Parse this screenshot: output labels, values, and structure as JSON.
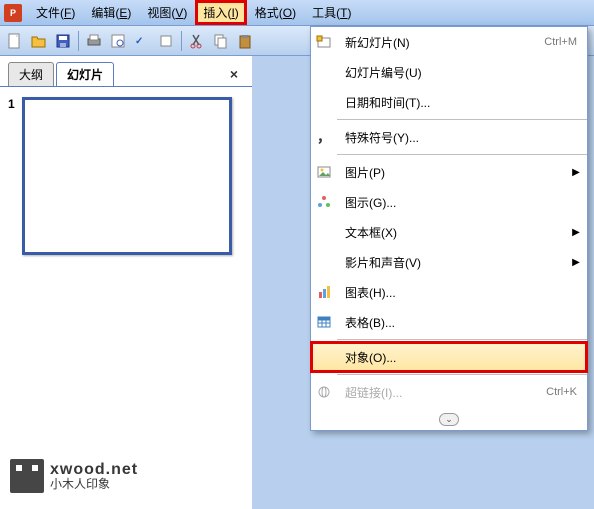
{
  "menubar": {
    "items": [
      {
        "label": "文件",
        "accel": "F"
      },
      {
        "label": "编辑",
        "accel": "E"
      },
      {
        "label": "视图",
        "accel": "V"
      },
      {
        "label": "插入",
        "accel": "I",
        "highlighted": true
      },
      {
        "label": "格式",
        "accel": "O"
      },
      {
        "label": "工具",
        "accel": "T"
      }
    ]
  },
  "tabs": {
    "outline": "大纲",
    "slides": "幻灯片",
    "close": "×"
  },
  "slide_number": "1",
  "dropdown": {
    "items": [
      {
        "icon": "new-slide-icon",
        "label": "新幻灯片(N)",
        "shortcut": "Ctrl+M"
      },
      {
        "icon": "",
        "label": "幻灯片编号(U)"
      },
      {
        "icon": "",
        "label": "日期和时间(T)...",
        "sep_after": true
      },
      {
        "icon": "symbol-icon",
        "label": "特殊符号(Y)...",
        "sep_after": true
      },
      {
        "icon": "picture-icon",
        "label": "图片(P)",
        "submenu": true
      },
      {
        "icon": "diagram-icon",
        "label": "图示(G)..."
      },
      {
        "icon": "",
        "label": "文本框(X)",
        "submenu": true
      },
      {
        "icon": "",
        "label": "影片和声音(V)",
        "submenu": true
      },
      {
        "icon": "chart-icon",
        "label": "图表(H)..."
      },
      {
        "icon": "table-icon",
        "label": "表格(B)...",
        "sep_after": true
      },
      {
        "icon": "",
        "label": "对象(O)...",
        "highlighted": true,
        "sep_after": true
      },
      {
        "icon": "hyperlink-icon",
        "label": "超链接(I)...",
        "shortcut": "Ctrl+K",
        "disabled": true
      }
    ],
    "expand": "⌄"
  },
  "watermark": {
    "domain": "xwood.net",
    "tag": "小木人印象"
  }
}
